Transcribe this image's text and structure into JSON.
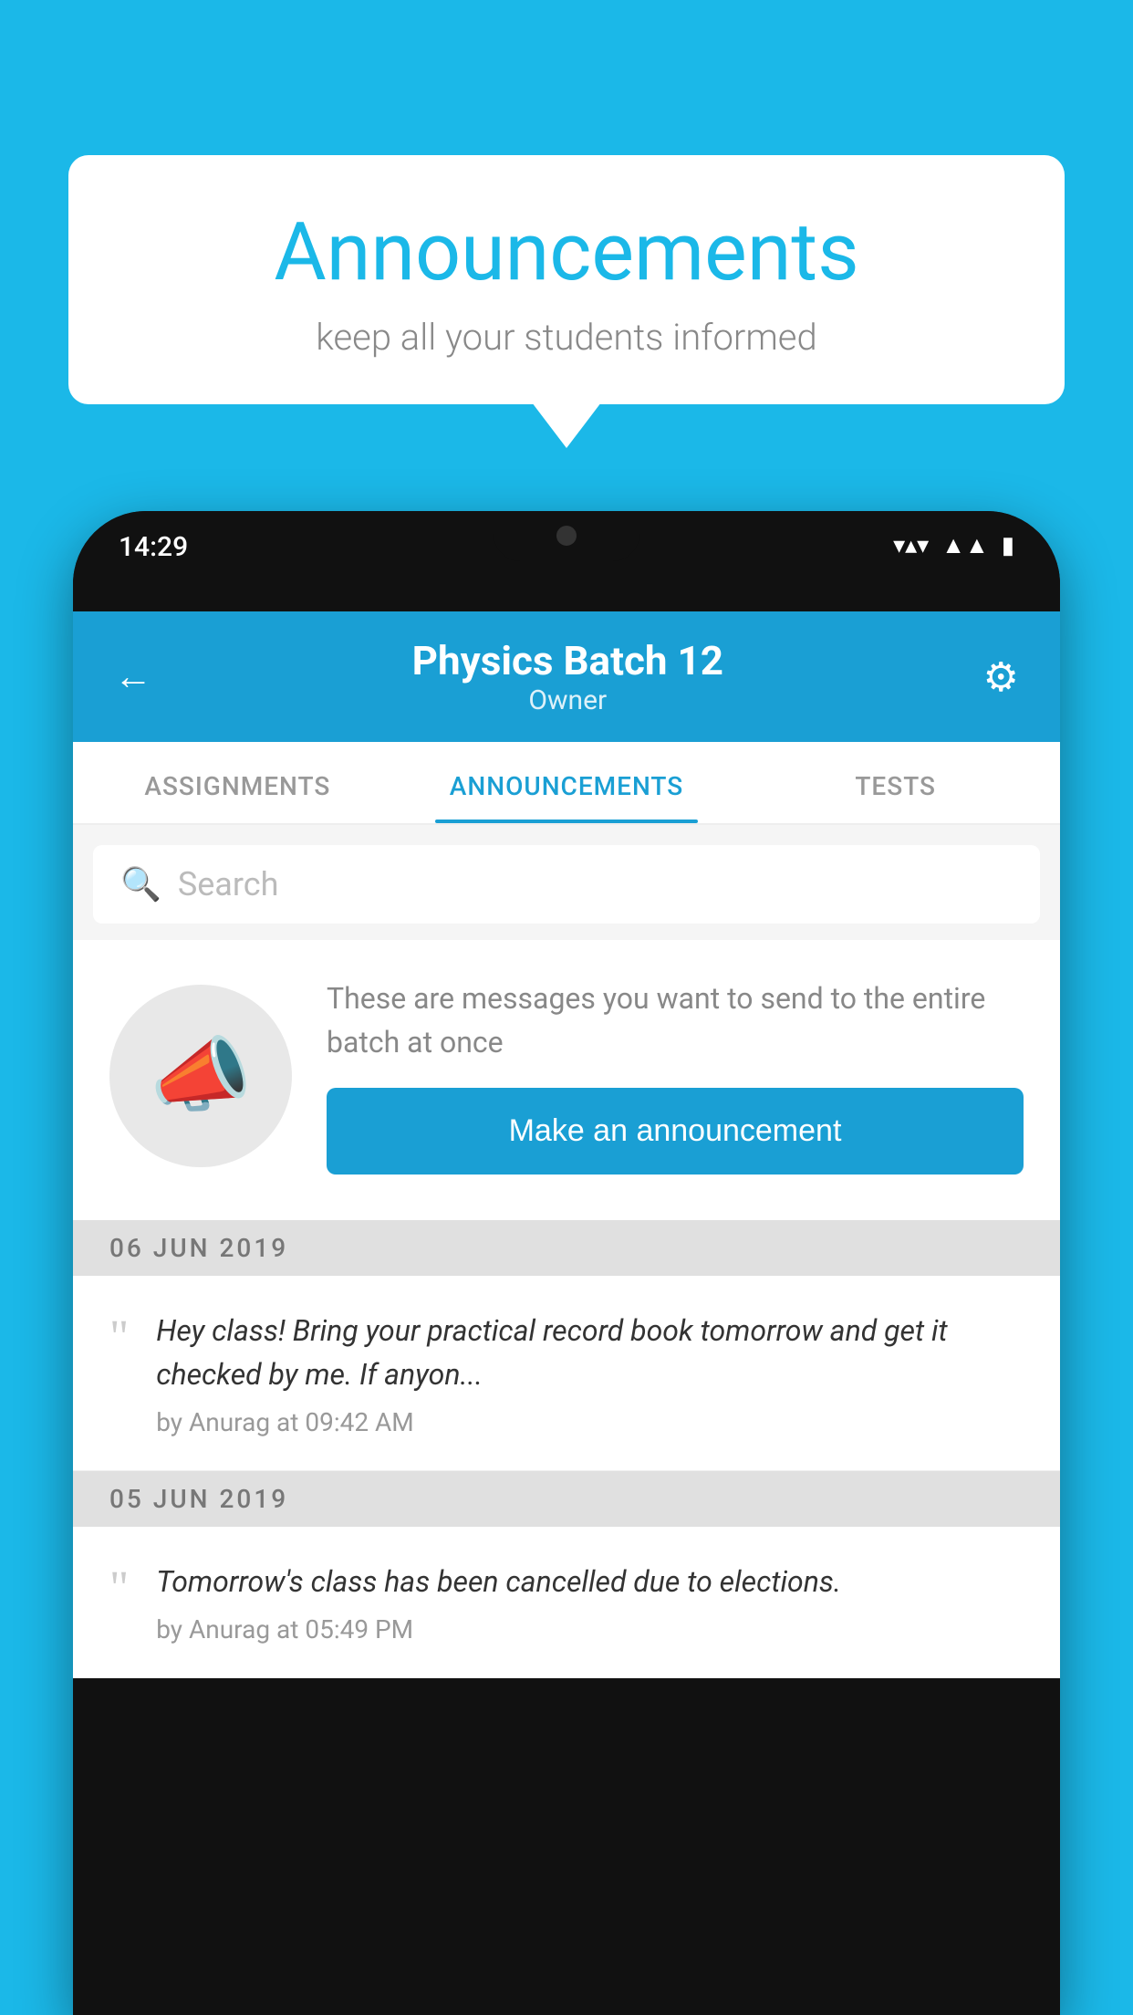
{
  "background": {
    "color": "#1BB8E8"
  },
  "speechBubble": {
    "title": "Announcements",
    "subtitle": "keep all your students informed"
  },
  "phone": {
    "statusBar": {
      "time": "14:29",
      "icons": [
        "wifi",
        "signal",
        "battery"
      ]
    },
    "header": {
      "title": "Physics Batch 12",
      "subtitle": "Owner",
      "backLabel": "←",
      "settingsLabel": "⚙"
    },
    "tabs": [
      {
        "label": "ASSIGNMENTS",
        "active": false
      },
      {
        "label": "ANNOUNCEMENTS",
        "active": true
      },
      {
        "label": "TESTS",
        "active": false
      }
    ],
    "search": {
      "placeholder": "Search"
    },
    "promoCard": {
      "description": "These are messages you want to send to the entire batch at once",
      "buttonLabel": "Make an announcement"
    },
    "announcements": [
      {
        "date": "06  JUN  2019",
        "items": [
          {
            "text": "Hey class! Bring your practical record book tomorrow and get it checked by me. If anyon...",
            "meta": "by Anurag at 09:42 AM"
          }
        ]
      },
      {
        "date": "05  JUN  2019",
        "items": [
          {
            "text": "Tomorrow's class has been cancelled due to elections.",
            "meta": "by Anurag at 05:49 PM"
          }
        ]
      }
    ]
  }
}
